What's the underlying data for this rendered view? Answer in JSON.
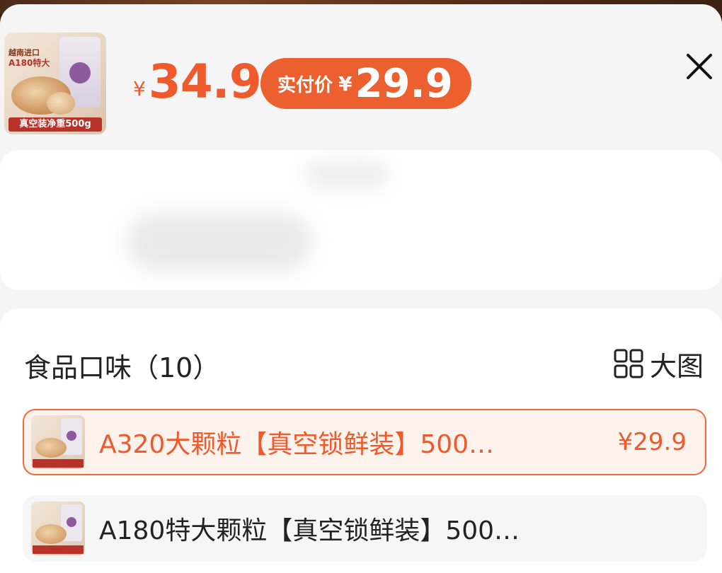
{
  "header": {
    "product_image_text": {
      "origin": "越南进口",
      "grade": "A180特大",
      "bottom_bar": "真空装净重500g"
    },
    "price": {
      "currency": "¥",
      "value": "34.9"
    },
    "actual_pay": {
      "label": "实付价",
      "currency": "¥",
      "value": "29.9"
    }
  },
  "options": {
    "section_title": "食品口味（10）",
    "big_view_label": "大图",
    "items": [
      {
        "name": "A320大颗粒【真空锁鲜装】500…",
        "price": "¥29.9",
        "selected": true
      },
      {
        "name": "A180特大颗粒【真空锁鲜装】500…",
        "price": "",
        "selected": false
      }
    ]
  },
  "colors": {
    "accent": "#ee5a2b",
    "pill": "#ec5f2f",
    "selected_bg": "#fdf2ec",
    "sheet_bg": "#f5f5f5"
  },
  "icons": {
    "close": "close-icon",
    "big_view": "grid-icon"
  }
}
